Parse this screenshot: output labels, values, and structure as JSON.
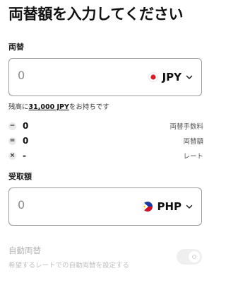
{
  "page": {
    "title": "両替額を入力してください"
  },
  "exchange": {
    "label": "両替",
    "amount": "0",
    "currency": "JPY",
    "flag_icon": "japan-flag-icon"
  },
  "balance": {
    "prefix": "残高に",
    "amount": "31,000 JPY",
    "suffix": "をお持ちです"
  },
  "fees": [
    {
      "op": "−",
      "value": "0",
      "label": "両替手数料"
    },
    {
      "op": "=",
      "value": "0",
      "label": "両替額"
    },
    {
      "op": "×",
      "value": "-",
      "label": "レート"
    }
  ],
  "receive": {
    "label": "受取額",
    "amount": "0",
    "currency": "PHP",
    "flag_icon": "philippines-flag-icon"
  },
  "auto_exchange": {
    "title": "自動両替",
    "description": "希望するレートでの自動両替を設定する",
    "enabled": false
  },
  "colors": {
    "text": "#111111",
    "border": "#9a9a9a",
    "disabled_text": "#b5b5b5",
    "japan_red": "#d4202c",
    "ph_blue": "#1a3a9c",
    "ph_red": "#ce1126",
    "ph_yellow": "#f5c400"
  }
}
